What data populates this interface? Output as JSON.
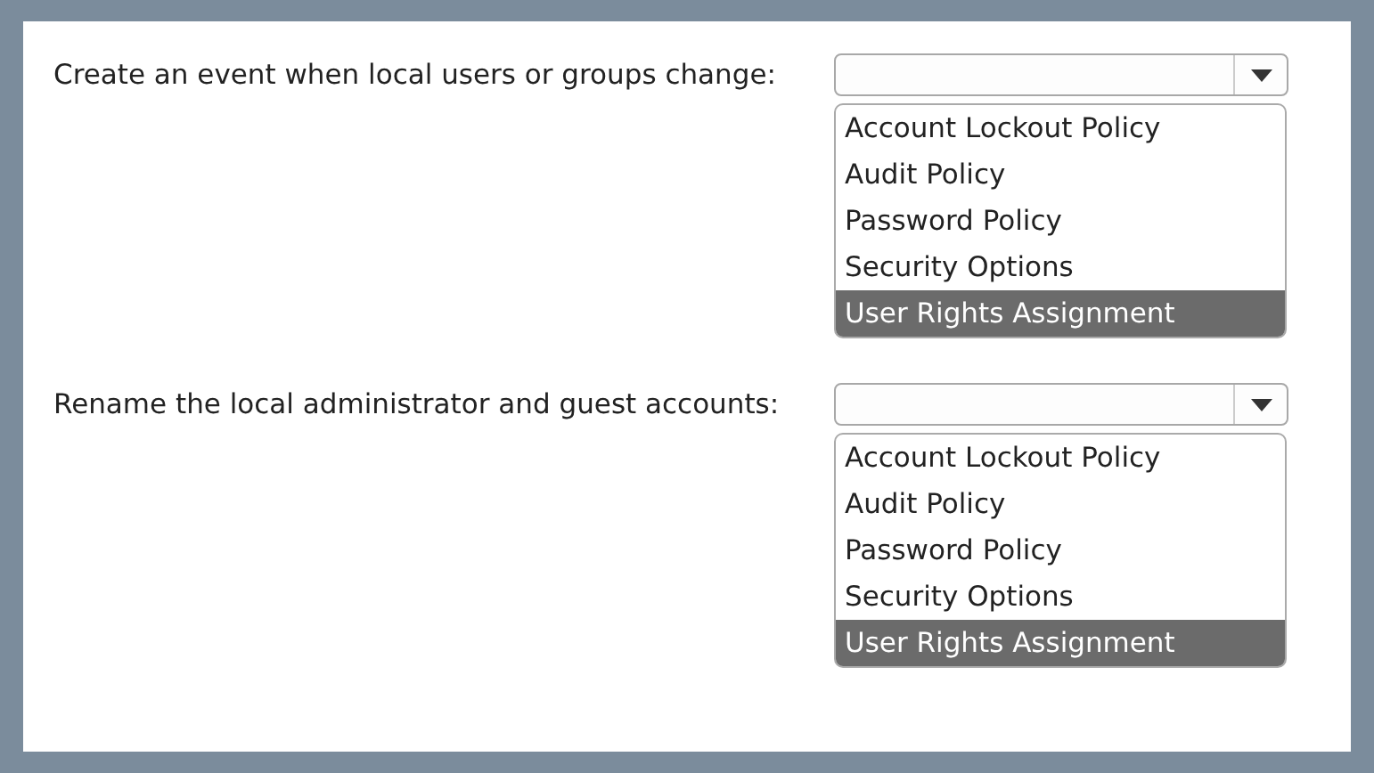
{
  "questions": [
    {
      "label": "Create an event when local users or groups change:",
      "dropdown": {
        "expanded": true,
        "options": [
          {
            "label": "Account Lockout Policy",
            "selected": false
          },
          {
            "label": "Audit Policy",
            "selected": false
          },
          {
            "label": "Password Policy",
            "selected": false
          },
          {
            "label": "Security Options",
            "selected": false
          },
          {
            "label": "User Rights Assignment",
            "selected": true
          }
        ]
      }
    },
    {
      "label": "Rename the local administrator and guest accounts:",
      "dropdown": {
        "expanded": true,
        "options": [
          {
            "label": "Account Lockout Policy",
            "selected": false
          },
          {
            "label": "Audit Policy",
            "selected": false
          },
          {
            "label": "Password Policy",
            "selected": false
          },
          {
            "label": "Security Options",
            "selected": false
          },
          {
            "label": "User Rights Assignment",
            "selected": true
          }
        ]
      }
    }
  ]
}
